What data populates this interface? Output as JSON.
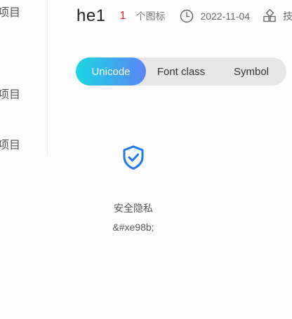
{
  "sidebar": {
    "items": [
      {
        "label": "项目"
      },
      {
        "label": "项目"
      },
      {
        "label": "项目"
      }
    ]
  },
  "header": {
    "title": "he1",
    "icon_count": "1",
    "count_unit": "个图标",
    "clock_icon": "clock-icon",
    "date": "2022-11-04",
    "layout_icon": "grid-icon",
    "cut_text": "技"
  },
  "tabs": [
    {
      "label": "Unicode",
      "active": true
    },
    {
      "label": "Font class",
      "active": false
    },
    {
      "label": "Symbol",
      "active": false
    }
  ],
  "icon_card": {
    "icon": "shield-check-icon",
    "name": "安全隐私",
    "code": "&#xe98b;",
    "color": "#1d7ae8"
  },
  "colors": {
    "accent_gradient_start": "#19d8e2",
    "accent_gradient_end": "#5b83f5",
    "count_red": "#d72a2a",
    "icon_blue": "#1d7ae8"
  }
}
